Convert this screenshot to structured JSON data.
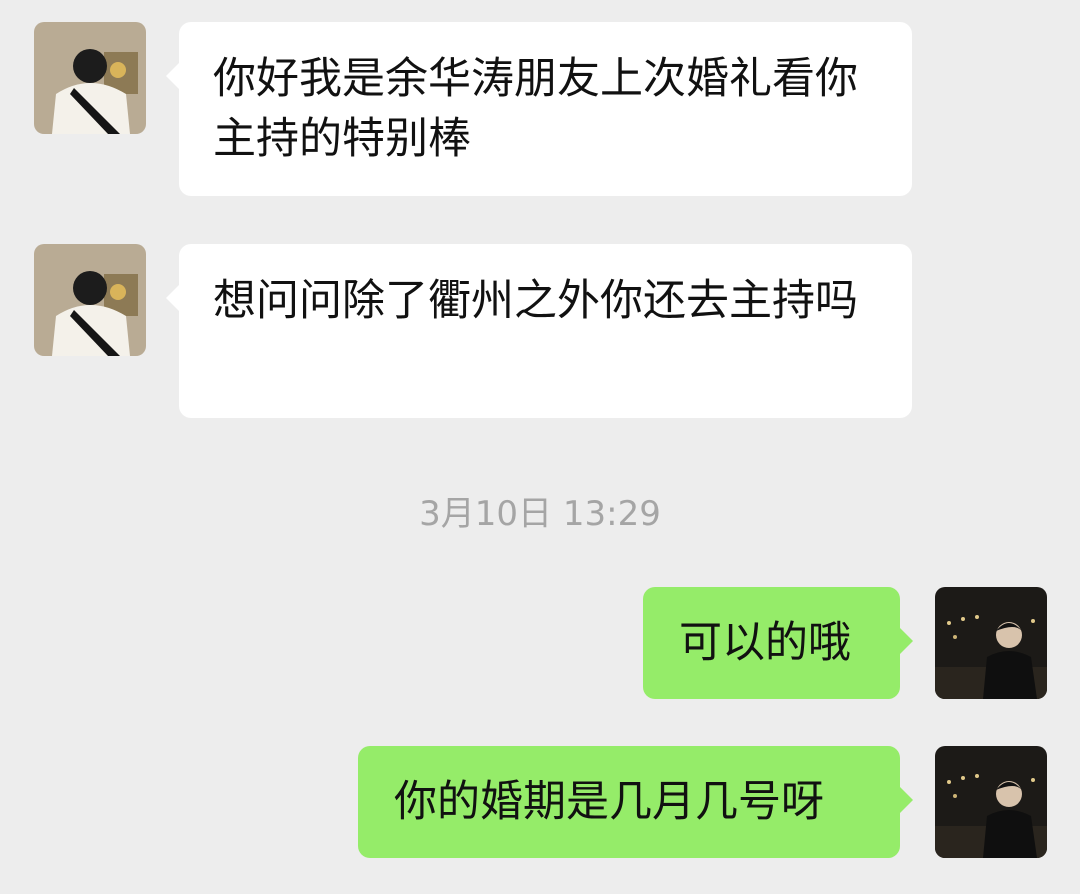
{
  "messages": [
    {
      "direction": "incoming",
      "text": "你好我是余华涛朋友上次婚礼看你主持的特别棒"
    },
    {
      "direction": "incoming",
      "text": "想问问除了衢州之外你还去主持吗"
    },
    {
      "direction": "outgoing",
      "text": "可以的哦"
    },
    {
      "direction": "outgoing",
      "text": "你的婚期是几月几号呀"
    }
  ],
  "timestamp": "3月10日 13:29",
  "colors": {
    "background": "#ededed",
    "incoming_bubble": "#ffffff",
    "outgoing_bubble": "#95ec69",
    "timestamp_text": "#a5a5a5"
  },
  "icons": {
    "contact_avatar": "avatar-icon",
    "self_avatar": "avatar-icon"
  }
}
